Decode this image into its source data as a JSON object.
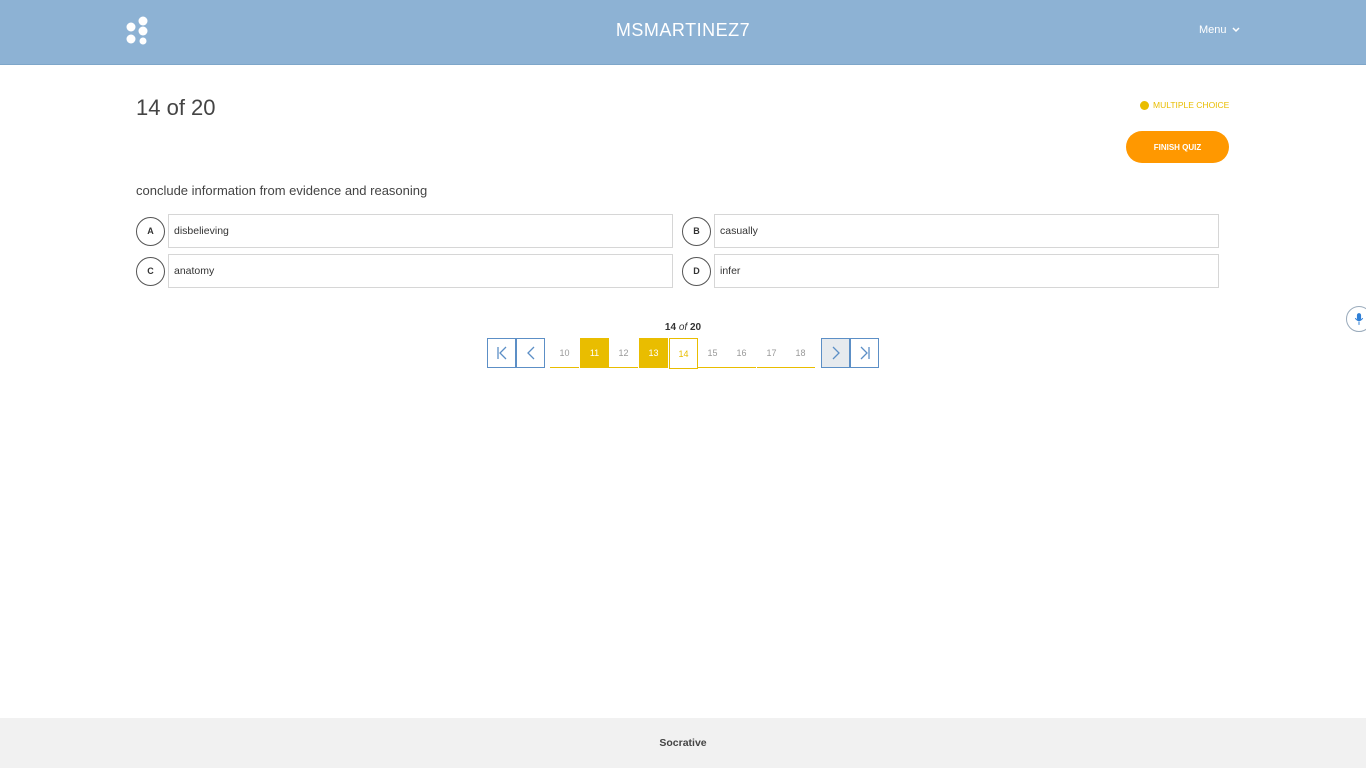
{
  "header": {
    "room_name": "MSMARTINEZ7",
    "menu_label": "Menu",
    "logo_icon": "socrative-hexagon-logo",
    "background_color": "#8db2d4"
  },
  "quiz": {
    "progress_title": "14 of 20",
    "question_type": "MULTIPLE CHOICE",
    "finish_label": "FINISH QUIZ",
    "accent_color": "#e9bd00",
    "finish_color": "#ff9800"
  },
  "question": {
    "text": "conclude information from evidence and reasoning",
    "answers": [
      {
        "letter": "A",
        "text": "disbelieving"
      },
      {
        "letter": "B",
        "text": "casually"
      },
      {
        "letter": "C",
        "text": "anatomy"
      },
      {
        "letter": "D",
        "text": "infer"
      }
    ]
  },
  "pager": {
    "current": "14",
    "of_word": "of",
    "total": "20",
    "pages": [
      {
        "num": "10",
        "state": "unanswered"
      },
      {
        "num": "11",
        "state": "answered"
      },
      {
        "num": "12",
        "state": "unanswered"
      },
      {
        "num": "13",
        "state": "answered"
      },
      {
        "num": "14",
        "state": "current"
      },
      {
        "num": "15",
        "state": "unanswered"
      },
      {
        "num": "16",
        "state": "unanswered"
      },
      {
        "num": "17",
        "state": "unanswered"
      },
      {
        "num": "18",
        "state": "unanswered"
      }
    ],
    "icons": [
      "first-page-icon",
      "previous-page-icon",
      "next-page-icon",
      "last-page-icon"
    ]
  },
  "footer": {
    "brand": "Socrative"
  }
}
